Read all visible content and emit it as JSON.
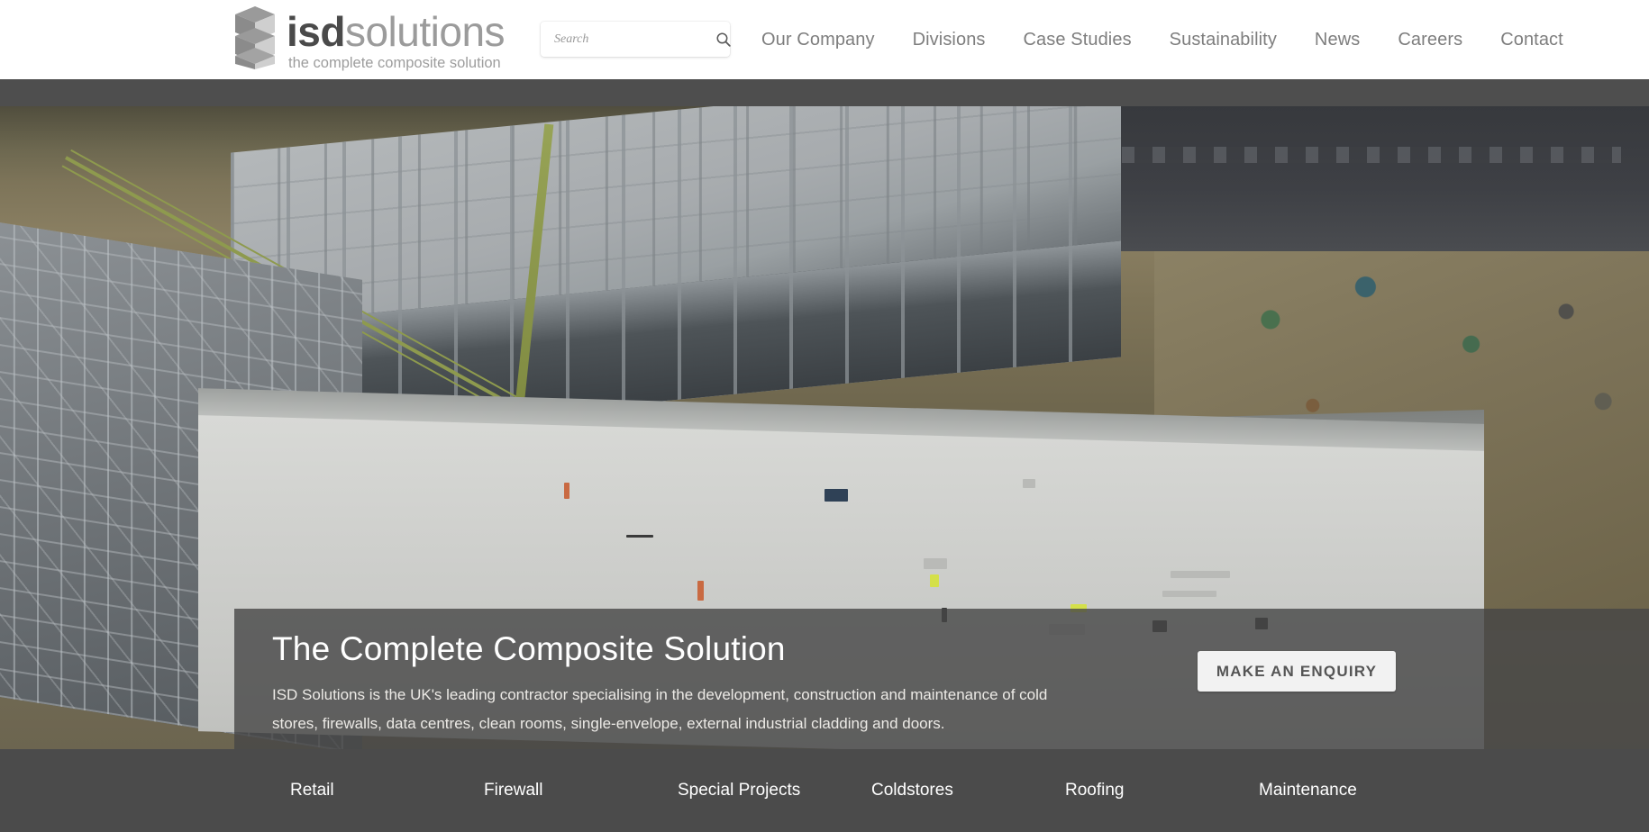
{
  "header": {
    "logo": {
      "icon": "isd-cubes-logo-icon",
      "name_bold": "isd",
      "name_light": "solutions",
      "tagline": "the complete composite solution"
    },
    "search": {
      "placeholder": "Search",
      "value": "",
      "icon": "search-icon"
    },
    "nav": [
      {
        "label": "Our Company"
      },
      {
        "label": "Divisions"
      },
      {
        "label": "Case Studies"
      },
      {
        "label": "Sustainability"
      },
      {
        "label": "News"
      },
      {
        "label": "Careers"
      },
      {
        "label": "Contact"
      }
    ]
  },
  "hero": {
    "title": "The Complete Composite Solution",
    "description": "ISD Solutions is the UK's leading contractor specialising in the development, construction and maintenance of cold stores, firewalls, data centres, clean rooms, single-envelope, external industrial cladding and doors.",
    "cta_label": "MAKE AN ENQUIRY"
  },
  "categories": [
    {
      "label": "Retail"
    },
    {
      "label": "Firewall"
    },
    {
      "label": "Special Projects"
    },
    {
      "label": "Coldstores"
    },
    {
      "label": "Roofing"
    },
    {
      "label": "Maintenance"
    }
  ],
  "colors": {
    "header_bg": "#ffffff",
    "sub_bar": "#4e4e4e",
    "overlay": "#464646",
    "category_band": "#4b4b4b",
    "nav_text": "#7e7e7e",
    "logo_dark": "#4a4a4a",
    "logo_light": "#9b9b9b",
    "cta_bg": "#f2f2f2",
    "cta_text": "#555555"
  }
}
